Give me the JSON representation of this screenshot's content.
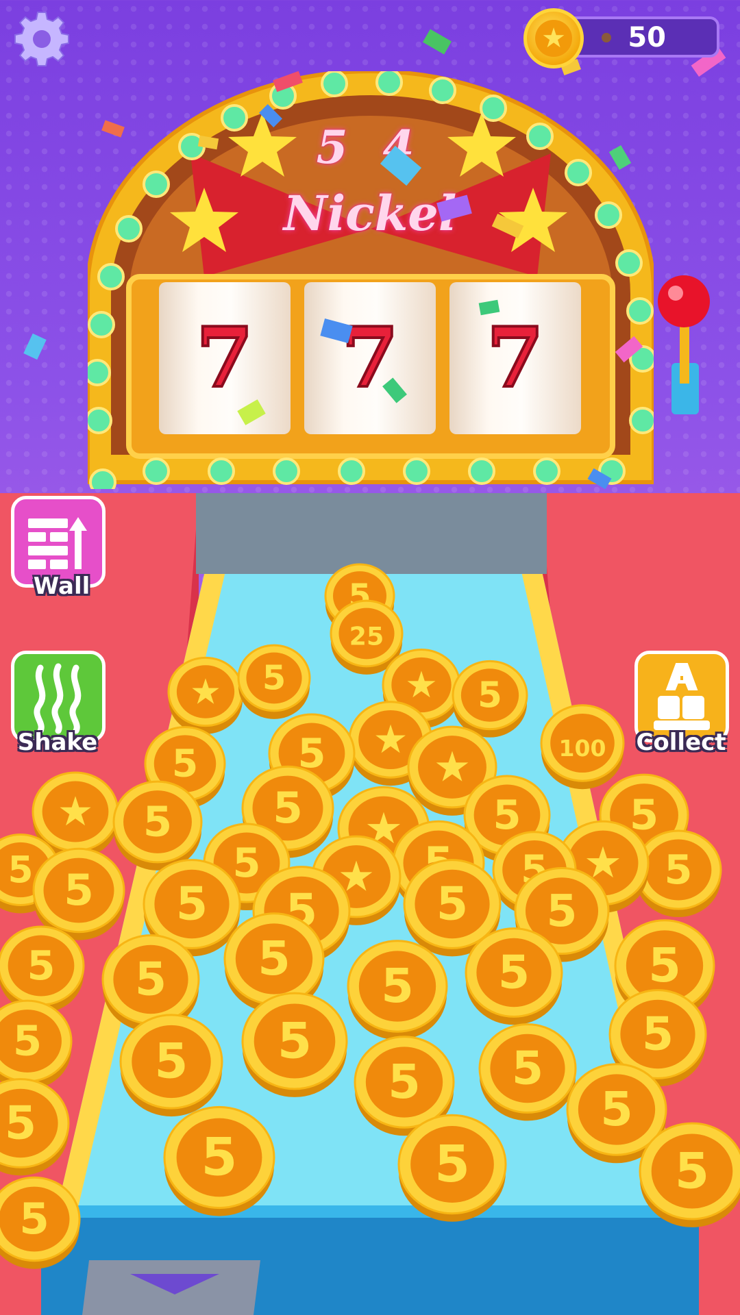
{
  "hud": {
    "coin_count": "50",
    "settings_icon": "gear-icon",
    "currency_icon": "star-coin-icon"
  },
  "machine": {
    "marquee_number": "5 4",
    "marquee_title": "Nickel",
    "reels": [
      "7",
      "7",
      "7"
    ]
  },
  "powerups": {
    "wall_label": "Wall",
    "shake_label": "Shake",
    "collect_label": "Collect",
    "wall_icon": "wall-up-icon",
    "shake_icon": "shake-wave-icon",
    "collect_icon": "abc-letters-icon"
  },
  "coins": {
    "denominations": [
      "5",
      "25",
      "100"
    ],
    "star_coin_symbol": "★"
  },
  "colors": {
    "background": "#8d52e8",
    "machine_gold": "#f5b81c",
    "machine_red": "#e0434f",
    "playfield": "#7fe3f6",
    "coin_gold": "#f7b514",
    "coin_orange": "#f08a0c",
    "wall_button": "#e64fc9",
    "shake_button": "#5ec83a",
    "collect_button": "#f7b21b"
  }
}
